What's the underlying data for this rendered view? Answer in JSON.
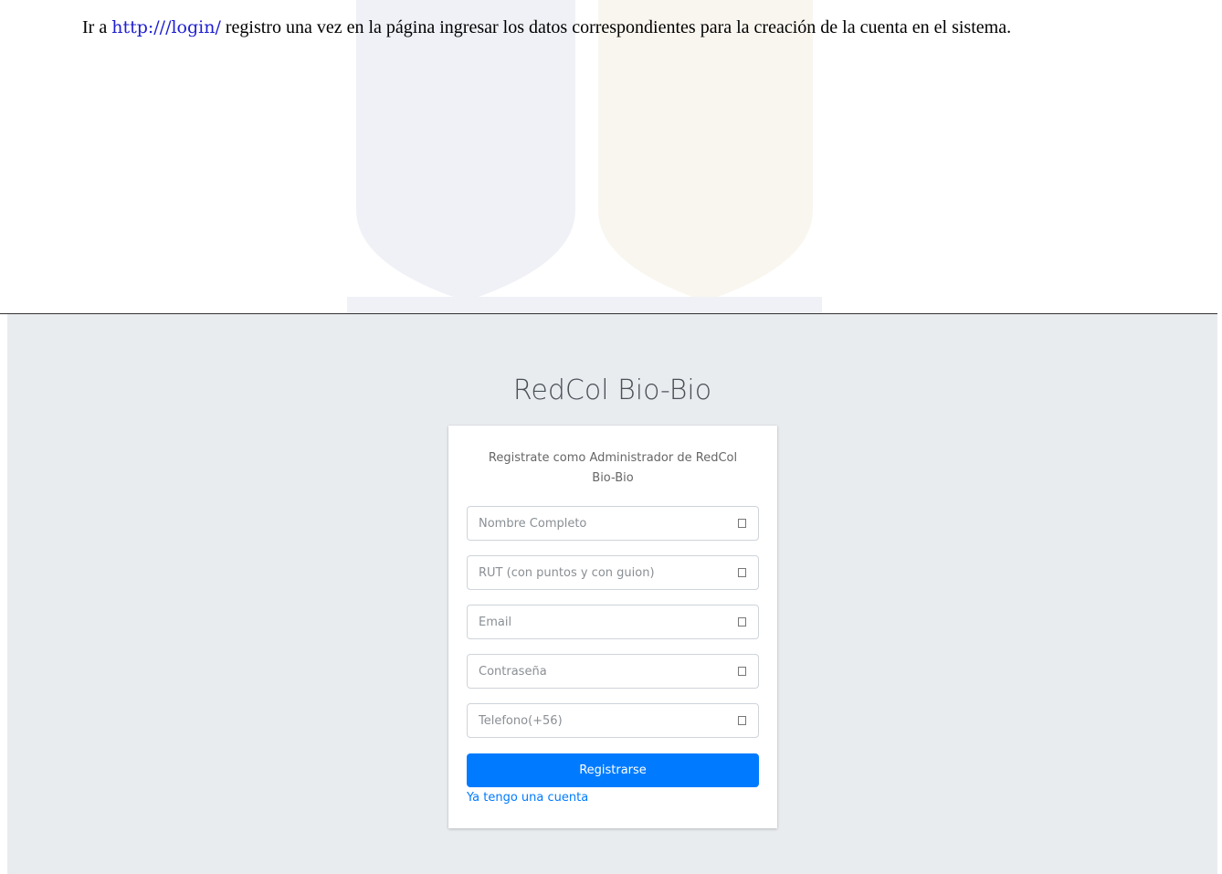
{
  "document": {
    "intro_before_link": "Ir a ",
    "link_text": "http:///login/",
    "intro_after_link": " registro una vez en la página ingresar los datos correspondientes para la creación de la cuenta en el sistema."
  },
  "app": {
    "brand": "RedCol Bio-Bio",
    "card_message": "Registrate como Administrador de RedCol Bio-Bio",
    "fields": [
      {
        "placeholder": "Nombre Completo",
        "icon": "user-icon"
      },
      {
        "placeholder": "RUT (con puntos y con guion)",
        "icon": "id-card-icon"
      },
      {
        "placeholder": "Email",
        "icon": "envelope-icon"
      },
      {
        "placeholder": "Contraseña",
        "icon": "lock-icon"
      },
      {
        "placeholder": "Telefono(+56)",
        "icon": "phone-icon"
      }
    ],
    "submit_label": "Registrarse",
    "login_link": "Ya tengo una cuenta"
  },
  "colors": {
    "primary": "#007bff",
    "background": "#e9ecef",
    "link": "#1f1fd0"
  }
}
